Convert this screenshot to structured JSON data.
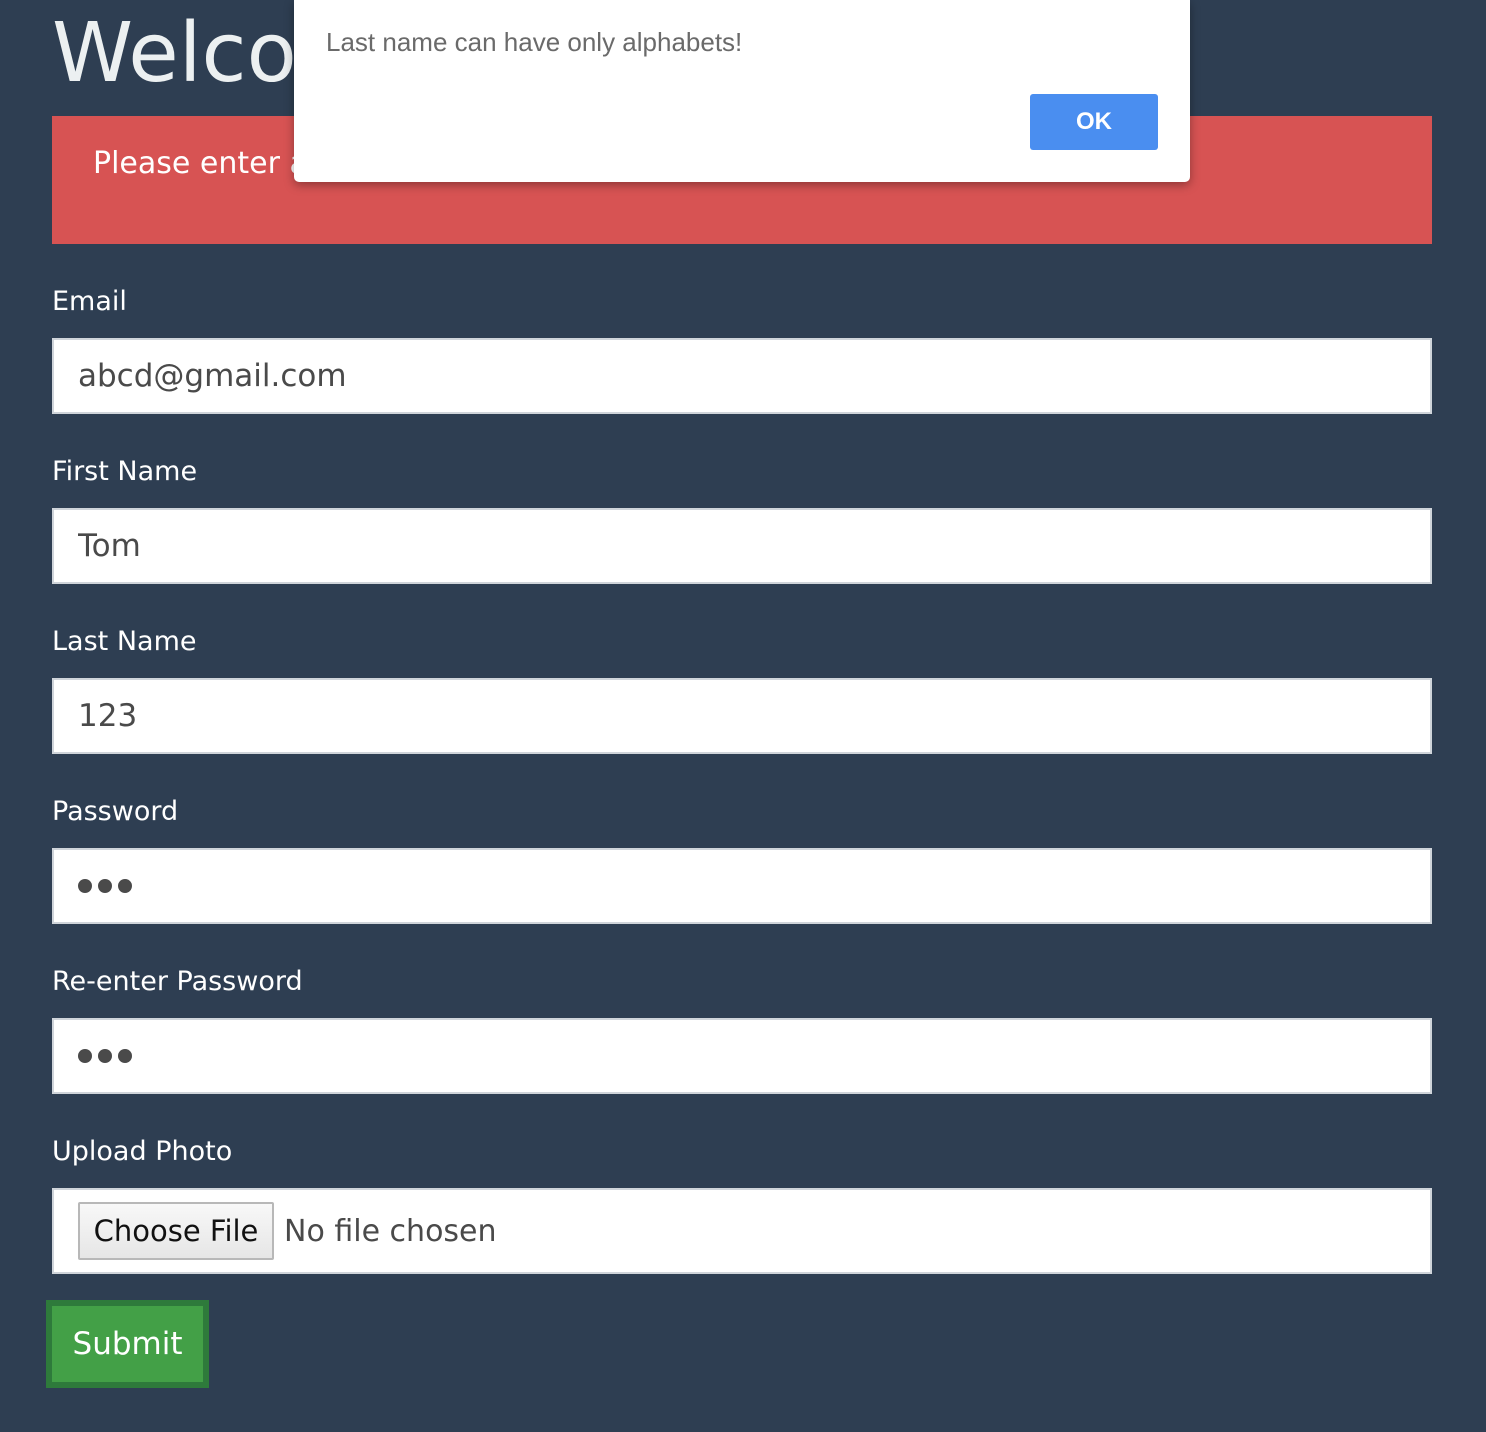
{
  "page": {
    "title": "Welcome"
  },
  "alert": {
    "message": "Please enter a"
  },
  "form": {
    "email": {
      "label": "Email",
      "value": "abcd@gmail.com"
    },
    "first_name": {
      "label": "First Name",
      "value": "Tom"
    },
    "last_name": {
      "label": "Last Name",
      "value": "123"
    },
    "password": {
      "label": "Password",
      "masked_length": 3
    },
    "reenter_password": {
      "label": "Re-enter Password",
      "masked_length": 3
    },
    "upload_photo": {
      "label": "Upload Photo",
      "button_label": "Choose File",
      "status": "No file chosen"
    },
    "submit_label": "Submit"
  },
  "dialog": {
    "message": "Last name can have only alphabets!",
    "ok_label": "OK"
  },
  "colors": {
    "background": "#2e3e52",
    "alert": "#d75353",
    "submit": "#43a047",
    "dialog_ok": "#4a8ef0"
  }
}
